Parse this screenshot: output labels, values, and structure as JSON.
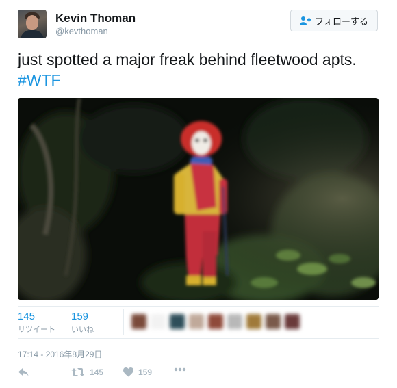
{
  "user": {
    "name": "Kevin Thoman",
    "handle": "@kevthoman"
  },
  "follow_button": {
    "icon": "add-user-icon",
    "label": "フォローする"
  },
  "tweet": {
    "text": "just spotted a major freak behind fleetwood apts.",
    "hashtag": "#WTF"
  },
  "stats": {
    "retweets_count": "145",
    "retweets_label": "リツイート",
    "likes_count": "159",
    "likes_label": "いいね"
  },
  "timestamp": "17:14 - 2016年8月29日",
  "actions": {
    "reply_icon": "reply-icon",
    "retweet_icon": "retweet-icon",
    "retweet_count": "145",
    "like_icon": "heart-icon",
    "like_count": "159",
    "more_icon": "more-icon"
  },
  "colors": {
    "link": "#1b95e0",
    "muted": "#8899a6",
    "action": "#aab8c2",
    "border": "#e6ecf0"
  }
}
